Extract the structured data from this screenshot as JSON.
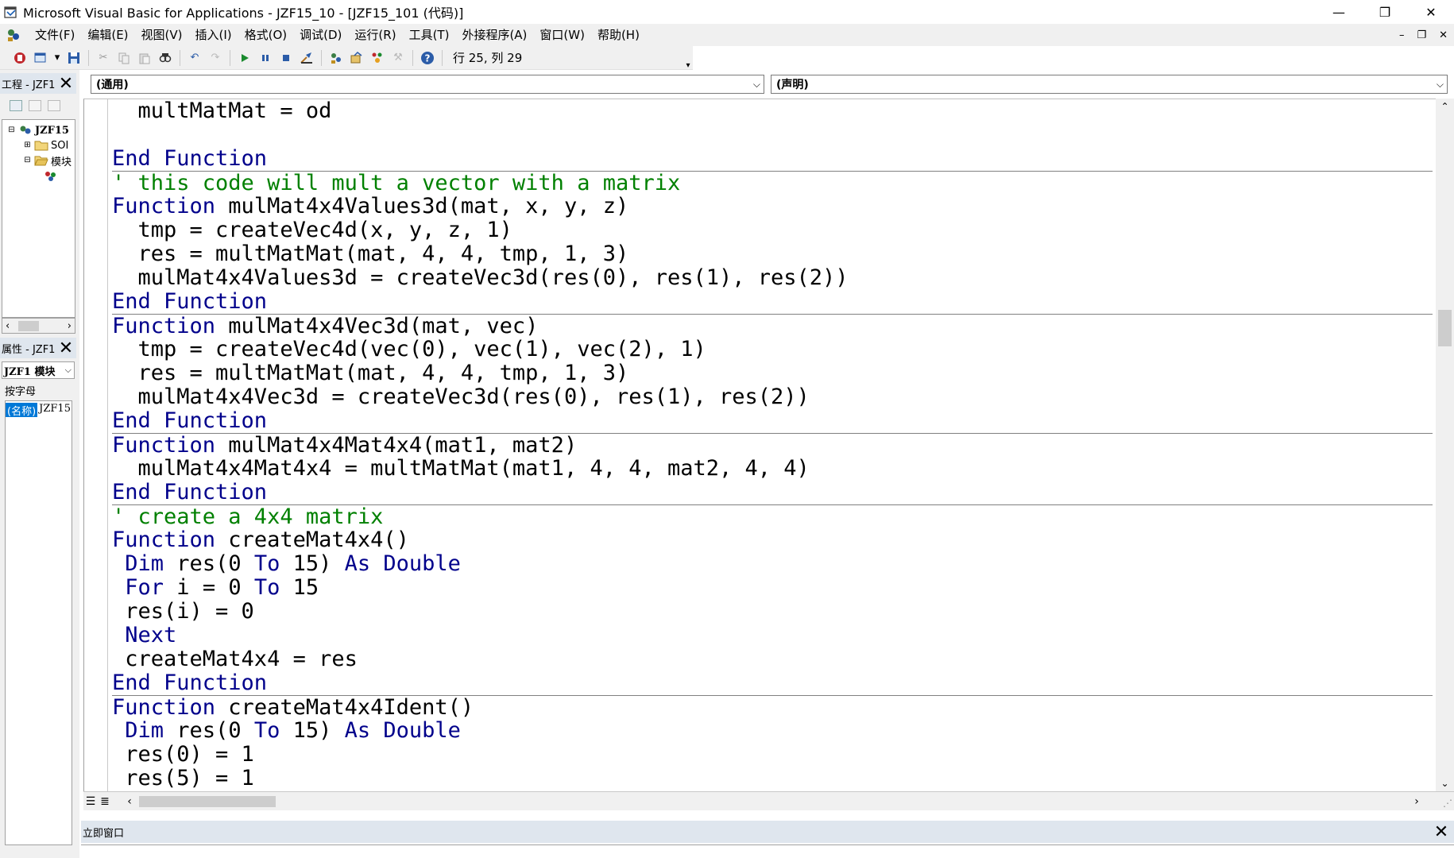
{
  "window": {
    "title": "Microsoft Visual Basic for Applications - JZF15_10 - [JZF15_101 (代码)]",
    "minimize": "—",
    "restore": "❐",
    "close": "✕"
  },
  "menu": {
    "items": [
      {
        "label": "文件(F)"
      },
      {
        "label": "编辑(E)"
      },
      {
        "label": "视图(V)"
      },
      {
        "label": "插入(I)"
      },
      {
        "label": "格式(O)"
      },
      {
        "label": "调试(D)"
      },
      {
        "label": "运行(R)"
      },
      {
        "label": "工具(T)"
      },
      {
        "label": "外接程序(A)"
      },
      {
        "label": "窗口(W)"
      },
      {
        "label": "帮助(H)"
      }
    ],
    "mdi_minimize": "–",
    "mdi_restore": "❐",
    "mdi_close": "✕"
  },
  "toolbar": {
    "position_text": "行 25, 列 29"
  },
  "project_panel": {
    "title": "工程 - JZF1",
    "tree": [
      {
        "box": "⊟",
        "label": "JZF15",
        "bold": true
      },
      {
        "box": "⊞",
        "label": "SOI"
      },
      {
        "box": "⊟",
        "label": "模块"
      },
      {
        "box": "",
        "label": ""
      }
    ]
  },
  "properties_panel": {
    "title": "属性 - JZF1",
    "object_combo": "JZF1 模块",
    "tab_label": "按字母",
    "rows": [
      {
        "name": "(名称)",
        "value": "JZF15"
      }
    ]
  },
  "code_window": {
    "object_combo": "(通用)",
    "procedure_combo": "(声明)",
    "lines": [
      {
        "sep": false,
        "tokens": [
          {
            "t": "  multMatMat = od",
            "c": "id"
          }
        ]
      },
      {
        "sep": false,
        "tokens": [
          {
            "t": "",
            "c": "id"
          }
        ]
      },
      {
        "sep": false,
        "tokens": [
          {
            "t": "End Function",
            "c": "kw"
          }
        ]
      },
      {
        "sep": true,
        "tokens": [
          {
            "t": "' this code will mult a vector with a matrix",
            "c": "cm"
          }
        ]
      },
      {
        "sep": false,
        "tokens": [
          {
            "t": "Function",
            "c": "kw"
          },
          {
            "t": " mulMat4x4Values3d(mat, x, y, z)",
            "c": "id"
          }
        ]
      },
      {
        "sep": false,
        "tokens": [
          {
            "t": "  tmp = createVec4d(x, y, z, 1)",
            "c": "id"
          }
        ]
      },
      {
        "sep": false,
        "tokens": [
          {
            "t": "  res = multMatMat(mat, 4, 4, tmp, 1, 3)",
            "c": "id"
          }
        ]
      },
      {
        "sep": false,
        "tokens": [
          {
            "t": "  mulMat4x4Values3d = createVec3d(res(0), res(1), res(2))",
            "c": "id"
          }
        ]
      },
      {
        "sep": false,
        "tokens": [
          {
            "t": "End Function",
            "c": "kw"
          }
        ]
      },
      {
        "sep": true,
        "tokens": [
          {
            "t": "Function",
            "c": "kw"
          },
          {
            "t": " mulMat4x4Vec3d(mat, vec)",
            "c": "id"
          }
        ]
      },
      {
        "sep": false,
        "tokens": [
          {
            "t": "  tmp = createVec4d(vec(0), vec(1), vec(2), 1)",
            "c": "id"
          }
        ]
      },
      {
        "sep": false,
        "tokens": [
          {
            "t": "  res = multMatMat(mat, 4, 4, tmp, 1, 3)",
            "c": "id"
          }
        ]
      },
      {
        "sep": false,
        "tokens": [
          {
            "t": "  mulMat4x4Vec3d = createVec3d(res(0), res(1), res(2))",
            "c": "id"
          }
        ]
      },
      {
        "sep": false,
        "tokens": [
          {
            "t": "End Function",
            "c": "kw"
          }
        ]
      },
      {
        "sep": true,
        "tokens": [
          {
            "t": "Function",
            "c": "kw"
          },
          {
            "t": " mulMat4x4Mat4x4(mat1, mat2)",
            "c": "id"
          }
        ]
      },
      {
        "sep": false,
        "tokens": [
          {
            "t": "  mulMat4x4Mat4x4 = multMatMat(mat1, 4, 4, mat2, 4, 4)",
            "c": "id"
          }
        ]
      },
      {
        "sep": false,
        "tokens": [
          {
            "t": "End Function",
            "c": "kw"
          }
        ]
      },
      {
        "sep": true,
        "tokens": [
          {
            "t": "' create a 4x4 matrix",
            "c": "cm"
          }
        ]
      },
      {
        "sep": false,
        "tokens": [
          {
            "t": "Function",
            "c": "kw"
          },
          {
            "t": " createMat4x4()",
            "c": "id"
          }
        ]
      },
      {
        "sep": false,
        "tokens": [
          {
            "t": " ",
            "c": "id"
          },
          {
            "t": "Dim",
            "c": "kw"
          },
          {
            "t": " res(0 ",
            "c": "id"
          },
          {
            "t": "To",
            "c": "kw"
          },
          {
            "t": " 15) ",
            "c": "id"
          },
          {
            "t": "As Double",
            "c": "kw"
          }
        ]
      },
      {
        "sep": false,
        "tokens": [
          {
            "t": " ",
            "c": "id"
          },
          {
            "t": "For",
            "c": "kw"
          },
          {
            "t": " i = 0 ",
            "c": "id"
          },
          {
            "t": "To",
            "c": "kw"
          },
          {
            "t": " 15",
            "c": "id"
          }
        ]
      },
      {
        "sep": false,
        "tokens": [
          {
            "t": " res(i) = 0",
            "c": "id"
          }
        ]
      },
      {
        "sep": false,
        "tokens": [
          {
            "t": " ",
            "c": "id"
          },
          {
            "t": "Next",
            "c": "kw"
          }
        ]
      },
      {
        "sep": false,
        "tokens": [
          {
            "t": " createMat4x4 = res",
            "c": "id"
          }
        ]
      },
      {
        "sep": false,
        "tokens": [
          {
            "t": "End Function",
            "c": "kw"
          }
        ]
      },
      {
        "sep": true,
        "tokens": [
          {
            "t": "Function",
            "c": "kw"
          },
          {
            "t": " createMat4x4Ident()",
            "c": "id"
          }
        ]
      },
      {
        "sep": false,
        "tokens": [
          {
            "t": " ",
            "c": "id"
          },
          {
            "t": "Dim",
            "c": "kw"
          },
          {
            "t": " res(0 ",
            "c": "id"
          },
          {
            "t": "To",
            "c": "kw"
          },
          {
            "t": " 15) ",
            "c": "id"
          },
          {
            "t": "As Double",
            "c": "kw"
          }
        ]
      },
      {
        "sep": false,
        "tokens": [
          {
            "t": " res(0) = 1",
            "c": "id"
          }
        ]
      },
      {
        "sep": false,
        "tokens": [
          {
            "t": " res(5) = 1",
            "c": "id"
          }
        ]
      }
    ]
  },
  "immediate_window": {
    "title": "立即窗口"
  },
  "colors": {
    "keyword": "#00008b",
    "comment": "#008000",
    "identifier": "#000000",
    "selection": "#0078d7"
  }
}
